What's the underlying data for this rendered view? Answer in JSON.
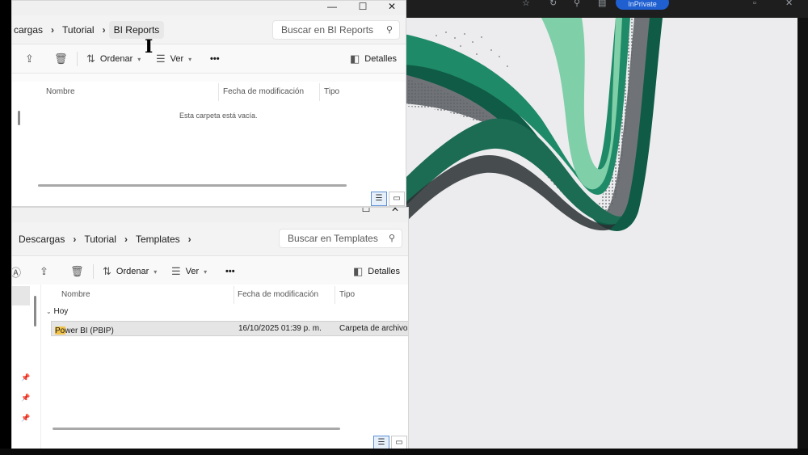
{
  "browser": {
    "profile_label": "InPrivate",
    "colors": {
      "bar": "#1e1e1e",
      "pill": "#1f5fd0"
    }
  },
  "wallpaper": {
    "colors": [
      "#0f5b45",
      "#1f8a67",
      "#7fcfa8",
      "#c9cccf"
    ]
  },
  "window_top": {
    "breadcrumb": [
      "cargas",
      "Tutorial",
      "BI Reports"
    ],
    "search_placeholder": "Buscar en BI Reports",
    "commands": {
      "sort": "Ordenar",
      "view": "Ver",
      "more": "•••",
      "details": "Detalles"
    },
    "columns": [
      "Nombre",
      "Fecha de modificación",
      "Tipo"
    ],
    "empty_message": "Esta carpeta está vacía.",
    "caption": {
      "minimize": "—",
      "maximize": "☐",
      "close": "✕"
    }
  },
  "window_bottom": {
    "breadcrumb": [
      "Descargas",
      "Tutorial",
      "Templates"
    ],
    "search_placeholder": "Buscar en Templates",
    "commands": {
      "sort": "Ordenar",
      "view": "Ver",
      "more": "•••",
      "details": "Detalles"
    },
    "columns": [
      "Nombre",
      "Fecha de modificación",
      "Tipo"
    ],
    "group_label": "Hoy",
    "files": [
      {
        "name": "Power BI (PBIP)",
        "modified": "16/10/2025 01:39 p. m.",
        "type": "Carpeta de archivos"
      }
    ]
  }
}
